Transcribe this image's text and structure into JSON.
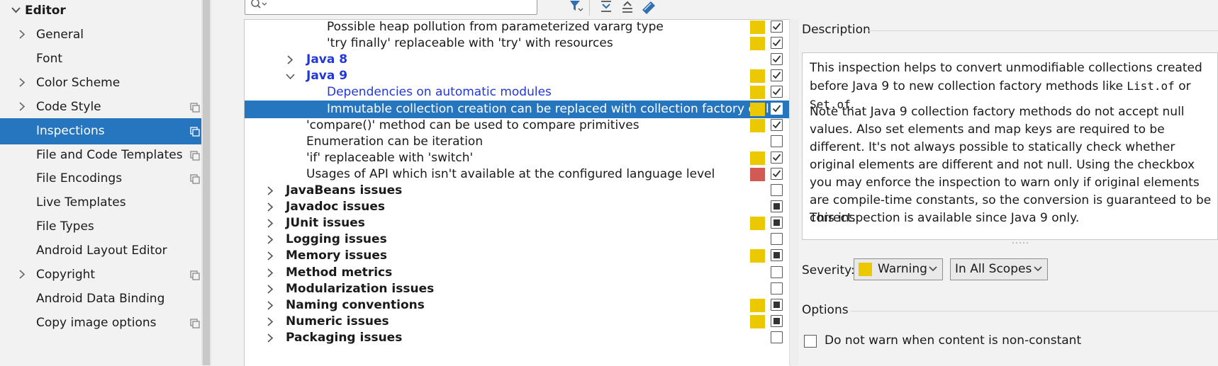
{
  "sidebar": {
    "header": "Editor",
    "items": [
      {
        "label": "General",
        "expandable": true,
        "copy_icon": false
      },
      {
        "label": "Font",
        "expandable": false,
        "copy_icon": false
      },
      {
        "label": "Color Scheme",
        "expandable": true,
        "copy_icon": false
      },
      {
        "label": "Code Style",
        "expandable": true,
        "copy_icon": true
      },
      {
        "label": "Inspections",
        "expandable": false,
        "copy_icon": true,
        "selected": true
      },
      {
        "label": "File and Code Templates",
        "expandable": false,
        "copy_icon": true
      },
      {
        "label": "File Encodings",
        "expandable": false,
        "copy_icon": true
      },
      {
        "label": "Live Templates",
        "expandable": false,
        "copy_icon": false
      },
      {
        "label": "File Types",
        "expandable": false,
        "copy_icon": false
      },
      {
        "label": "Android Layout Editor",
        "expandable": false,
        "copy_icon": false
      },
      {
        "label": "Copyright",
        "expandable": true,
        "copy_icon": true
      },
      {
        "label": "Android Data Binding",
        "expandable": false,
        "copy_icon": false
      },
      {
        "label": "Copy image options",
        "expandable": false,
        "copy_icon": true
      }
    ]
  },
  "search": {
    "value": "",
    "icon": "search-icon"
  },
  "toolbar": {
    "icons": [
      "filter-icon",
      "expand-all-icon",
      "collapse-all-icon",
      "reset-icon"
    ]
  },
  "colors": {
    "warning": "#ecc800",
    "error": "#d25a55",
    "selection": "#2675bf",
    "group_link": "#2238d6"
  },
  "tree": {
    "rows": [
      {
        "label": "Possible heap pollution from parameterized vararg type",
        "indent": 3,
        "arrow": "none",
        "style": "normal",
        "severity": "warning",
        "check": "checked"
      },
      {
        "label": "'try finally' replaceable with 'try' with resources",
        "indent": 3,
        "arrow": "none",
        "style": "normal",
        "severity": "warning",
        "check": "checked"
      },
      {
        "label": "Java 8",
        "indent": 2,
        "arrow": "right",
        "style": "group-blue",
        "severity": "none",
        "check": "checked"
      },
      {
        "label": "Java 9",
        "indent": 2,
        "arrow": "down",
        "style": "group-blue",
        "severity": "warning",
        "check": "checked"
      },
      {
        "label": "Dependencies on automatic modules",
        "indent": 3,
        "arrow": "none",
        "style": "blue",
        "severity": "warning",
        "check": "checked"
      },
      {
        "label": "Immutable collection creation can be replaced with collection factory call",
        "indent": 3,
        "arrow": "none",
        "style": "normal",
        "severity": "warning",
        "check": "checked",
        "selected": true
      },
      {
        "label": "'compare()' method can be used to compare primitives",
        "indent": 2,
        "arrow": "none",
        "style": "normal",
        "severity": "warning",
        "check": "checked"
      },
      {
        "label": "Enumeration can be iteration",
        "indent": 2,
        "arrow": "none",
        "style": "normal",
        "severity": "none",
        "check": "unchecked"
      },
      {
        "label": "'if' replaceable with 'switch'",
        "indent": 2,
        "arrow": "none",
        "style": "normal",
        "severity": "warning",
        "check": "checked"
      },
      {
        "label": "Usages of API which isn't available at the configured language level",
        "indent": 2,
        "arrow": "none",
        "style": "normal",
        "severity": "error",
        "check": "checked"
      },
      {
        "label": "JavaBeans issues",
        "indent": 1,
        "arrow": "right",
        "style": "bold",
        "severity": "none",
        "check": "unchecked"
      },
      {
        "label": "Javadoc issues",
        "indent": 1,
        "arrow": "right",
        "style": "bold",
        "severity": "none",
        "check": "partial"
      },
      {
        "label": "JUnit issues",
        "indent": 1,
        "arrow": "right",
        "style": "bold",
        "severity": "warning",
        "check": "partial"
      },
      {
        "label": "Logging issues",
        "indent": 1,
        "arrow": "right",
        "style": "bold",
        "severity": "none",
        "check": "unchecked"
      },
      {
        "label": "Memory issues",
        "indent": 1,
        "arrow": "right",
        "style": "bold",
        "severity": "warning",
        "check": "partial"
      },
      {
        "label": "Method metrics",
        "indent": 1,
        "arrow": "right",
        "style": "bold",
        "severity": "none",
        "check": "unchecked"
      },
      {
        "label": "Modularization issues",
        "indent": 1,
        "arrow": "right",
        "style": "bold",
        "severity": "none",
        "check": "unchecked"
      },
      {
        "label": "Naming conventions",
        "indent": 1,
        "arrow": "right",
        "style": "bold",
        "severity": "warning",
        "check": "partial"
      },
      {
        "label": "Numeric issues",
        "indent": 1,
        "arrow": "right",
        "style": "bold",
        "severity": "warning",
        "check": "partial"
      },
      {
        "label": "Packaging issues",
        "indent": 1,
        "arrow": "right",
        "style": "bold",
        "severity": "none",
        "check": "unchecked"
      }
    ]
  },
  "description": {
    "title": "Description",
    "p1_before": "This inspection helps to convert unmodifiable collections created before Java 9 to new collection factory methods like ",
    "p1_code1": "List.of",
    "p1_mid": " or ",
    "p1_code2": "Set.of",
    "p1_after": ".",
    "p2": "Note that Java 9 collection factory methods do not accept null values. Also set elements and map keys are required to be different. It's not always possible to statically check whether original elements are different and not null. Using the checkbox you may enforce the inspection to warn only if original elements are compile-time constants, so the conversion is guaranteed to be correct.",
    "p3": "This inspection is available since Java 9 only."
  },
  "severity": {
    "label": "Severity:",
    "value": "Warning"
  },
  "scope": {
    "value": "In All Scopes"
  },
  "options": {
    "title": "Options",
    "checkbox_label": "Do not warn when content is non-constant",
    "checked": false
  }
}
